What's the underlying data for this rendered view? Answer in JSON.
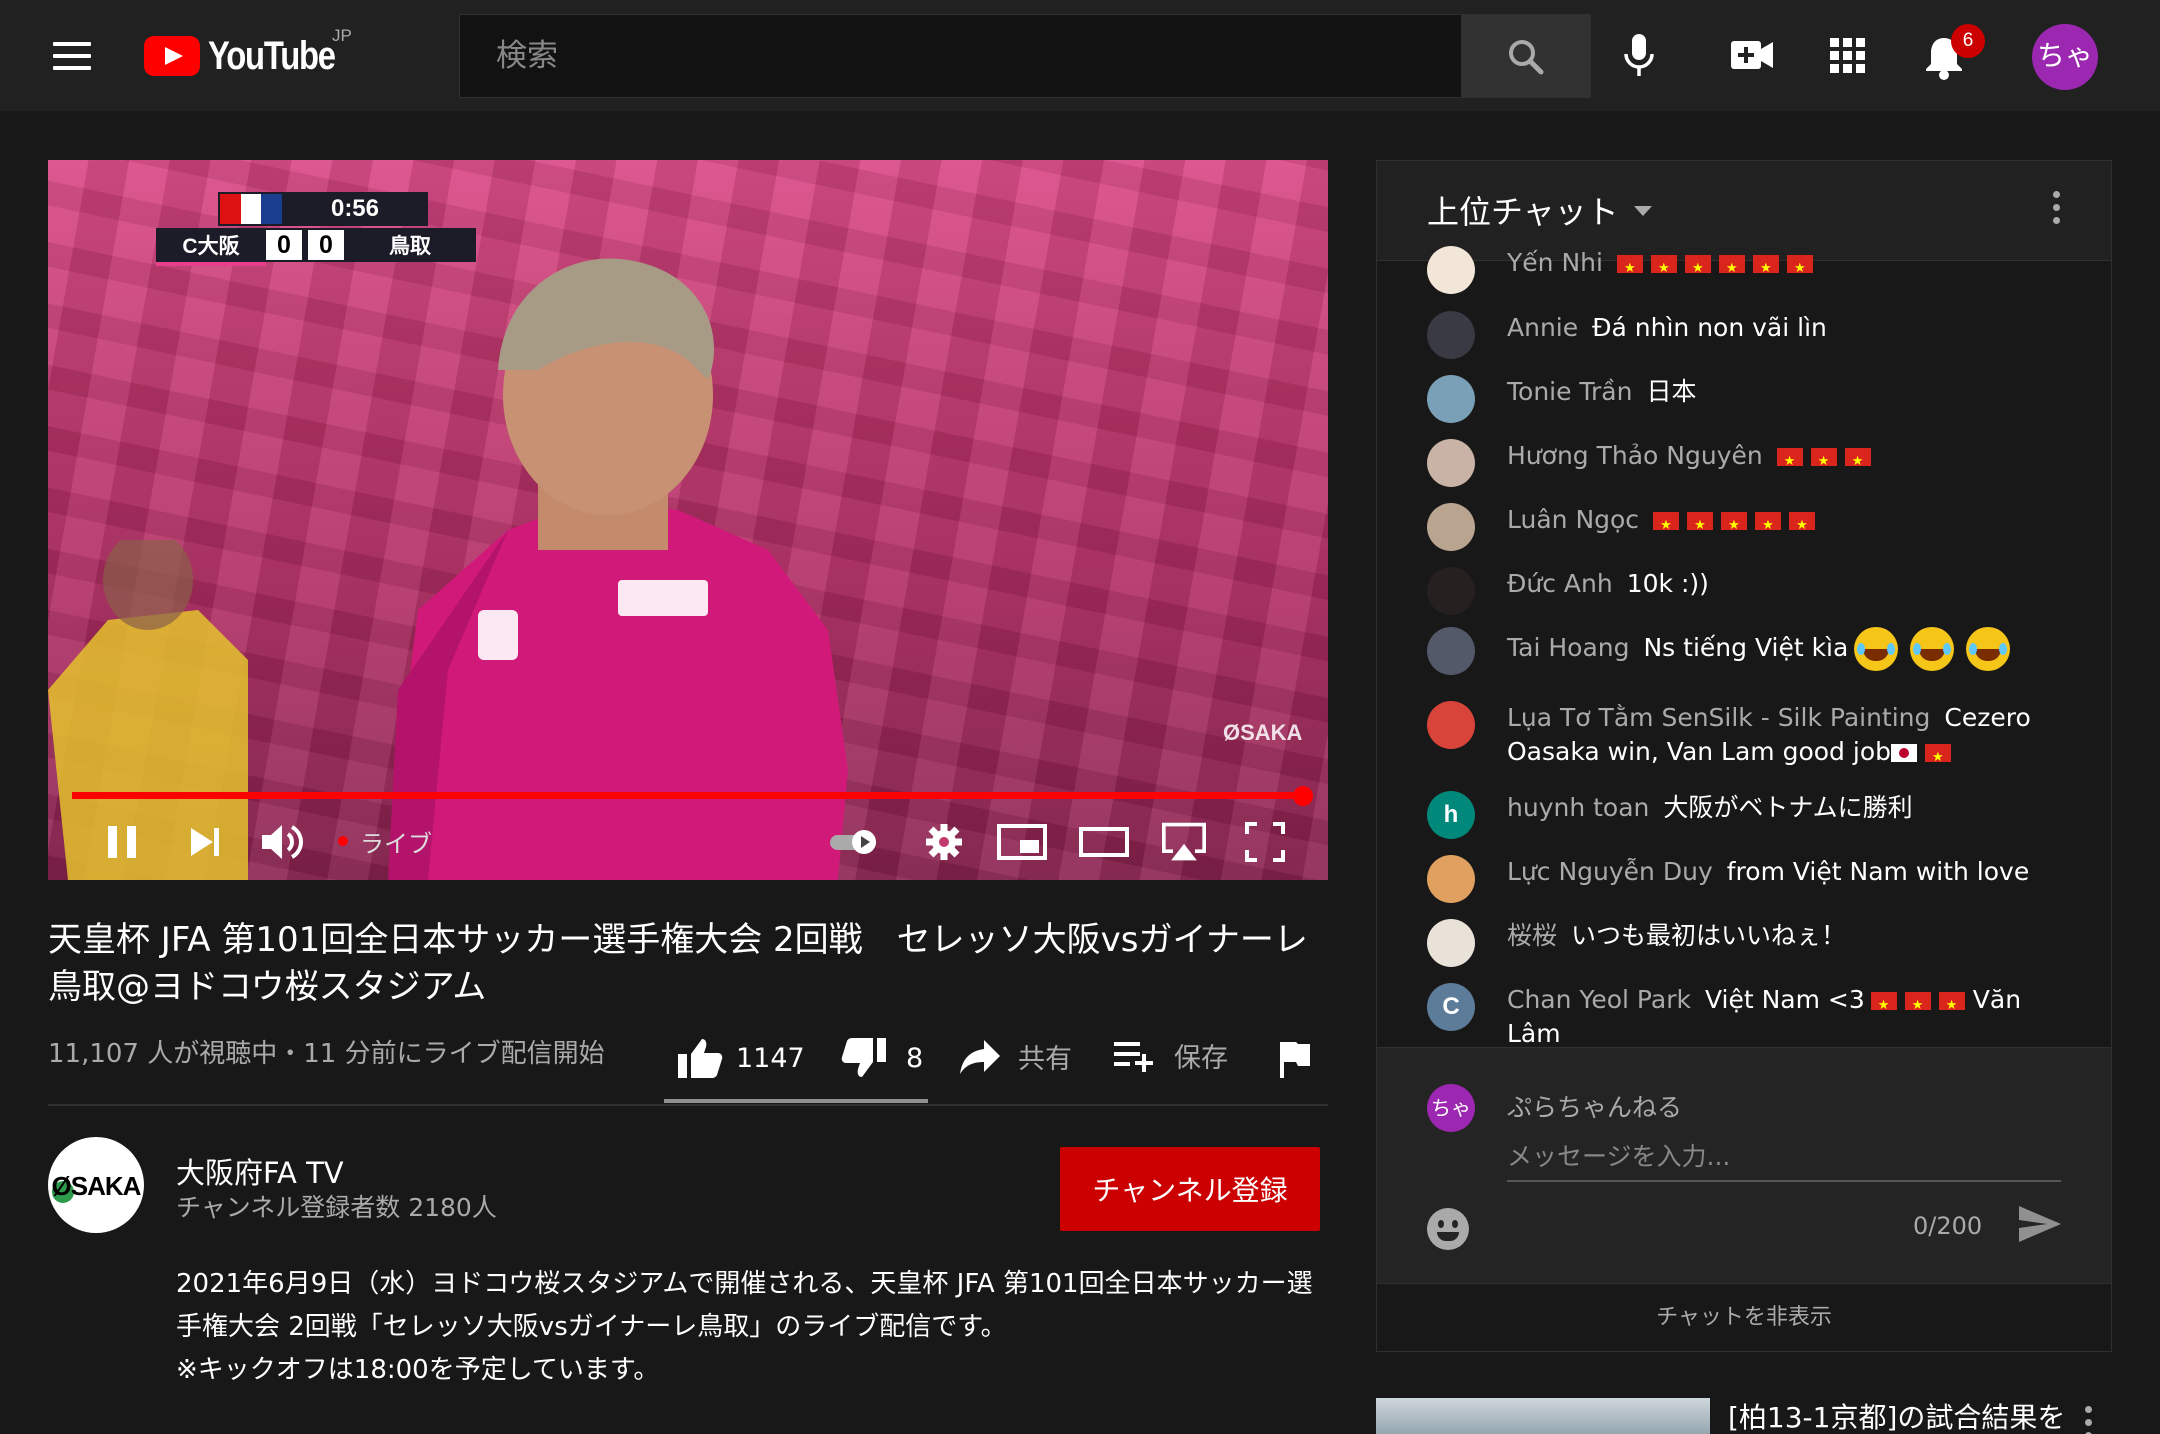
{
  "header": {
    "logo_text": "YouTube",
    "region": "JP",
    "search_placeholder": "検索",
    "notification_count": "6",
    "avatar_text": "ちゃ"
  },
  "video": {
    "scoreboard": {
      "clock": "0:56",
      "home_team": "C大阪",
      "home_score": "0",
      "away_score": "0",
      "away_team": "鳥取"
    },
    "watermark": "ØSAKA",
    "progress": 1.0,
    "live_label": "ライブ"
  },
  "info": {
    "title": "天皇杯 JFA 第101回全日本サッカー選手権大会 2回戦　セレッソ大阪vsガイナーレ鳥取@ヨドコウ桜スタジアム",
    "meta": "11,107 人が視聴中・11 分前にライブ配信開始",
    "likes": "1147",
    "dislikes": "8",
    "share_label": "共有",
    "save_label": "保存"
  },
  "channel": {
    "avatar_text": "ØSAKA",
    "name": "大阪府FA TV",
    "subscribers": "チャンネル登録者数 2180人",
    "subscribe_label": "チャンネル登録",
    "description": "2021年6月9日（水）ヨドコウ桜スタジアムで開催される、天皇杯 JFA 第101回全日本サッカー選手権大会 2回戦「セレッソ大阪vsガイナーレ鳥取」のライブ配信です。\n※キックオフは18:00を予定しています。"
  },
  "chat": {
    "title": "上位チャット",
    "messages": [
      {
        "author": "Yến Nhi",
        "text": "",
        "flags": 6,
        "avatar_color": "#f2e6d8"
      },
      {
        "author": "Annie",
        "text": "Đá nhìn non vãi lìn",
        "flags": 0,
        "avatar_color": "#3a3a44"
      },
      {
        "author": "Tonie Trần",
        "text": "日本",
        "flags": 0,
        "avatar_color": "#7aa0b8"
      },
      {
        "author": "Hương Thảo Nguyên",
        "text": "",
        "flags": 3,
        "avatar_color": "#c9b3a6"
      },
      {
        "author": "Luân Ngọc",
        "text": "",
        "flags": 5,
        "avatar_color": "#b9a48f"
      },
      {
        "author": "Đức Anh",
        "text": "10k :))",
        "flags": 0,
        "avatar_color": "#262020"
      },
      {
        "author": "Tai Hoang",
        "text": "Ns tiếng Việt kìa",
        "flags": 0,
        "avatar_color": "#54596a"
      },
      {
        "author": "Lụa Tơ Tằm SenSilk - Silk Painting",
        "text": "Cezero Oasaka win, Van Lam good job",
        "flags": 0,
        "avatar_color": "#d9443a"
      },
      {
        "author": "huynh toan",
        "text": "大阪がベトナムに勝利",
        "flags": 0,
        "avatar_letter": "h",
        "avatar_color": "#00897b"
      },
      {
        "author": "Lực Nguyễn Duy",
        "text": "from Việt Nam with love",
        "flags": 0,
        "avatar_color": "#e0a060"
      },
      {
        "author": "桜桜",
        "text": "いつも最初はいいねぇ！",
        "flags": 0,
        "avatar_color": "#e9e2d8"
      },
      {
        "author": "Chan Yeol Park",
        "text": "Việt Nam <3",
        "suffix": "Văn Lâm",
        "flags": 3,
        "avatar_letter": "C",
        "avatar_color": "#5c7c99"
      }
    ],
    "input": {
      "avatar_text": "ちゃ",
      "user_name": "ぷらちゃんねる",
      "placeholder": "メッセージを入力...",
      "counter": "0/200"
    },
    "hide_label": "チャットを非表示"
  },
  "related": {
    "title": "[柏13-1京都]の試合結果を"
  },
  "colors": {
    "accent_red": "#ff0000",
    "subscribe_red": "#cc0000",
    "avatar_purple": "#9c27b0"
  }
}
